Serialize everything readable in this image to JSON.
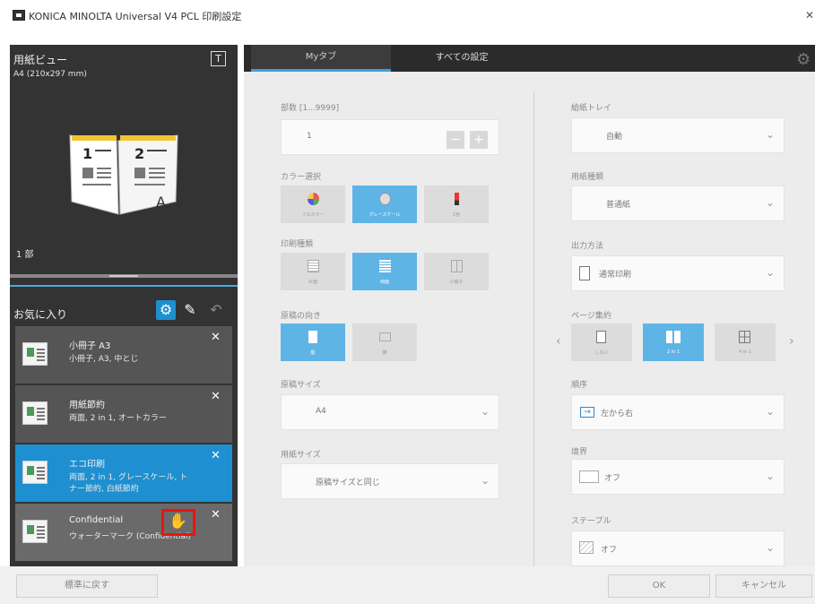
{
  "window": {
    "title": "KONICA MINOLTA Universal V4 PCL 印刷設定"
  },
  "preview": {
    "title": "用紙ビュー",
    "paper_size": "A4 (210x297 mm)",
    "copies_indicator": "1 部",
    "t_icon": "T"
  },
  "favorites": {
    "title": "お気に入り",
    "items": [
      {
        "name": "小冊子 A3",
        "desc": "小冊子, A3, 中とじ"
      },
      {
        "name": "用紙節約",
        "desc": "両面, 2 in 1, オートカラー"
      },
      {
        "name": "エコ印刷",
        "desc": "両面, 2 in 1, グレースケール, ト\nナー節約, 白紙節約"
      },
      {
        "name": "Confidential",
        "desc": "ウォーターマーク (Confidential)"
      }
    ]
  },
  "tabs": {
    "my": "Myタブ",
    "all": "すべての設定"
  },
  "left_col": {
    "copies": {
      "label": "部数 [1...9999]",
      "value": "1"
    },
    "color": {
      "label": "カラー選択",
      "options": [
        "フルカラー",
        "グレースケール",
        "2色"
      ]
    },
    "print_type": {
      "label": "印刷種類",
      "options": [
        "片面",
        "両面",
        "小冊子"
      ]
    },
    "orientation": {
      "label": "原稿の向き",
      "options": [
        "縦",
        "横"
      ]
    },
    "original_size": {
      "label": "原稿サイズ",
      "value": "A4"
    },
    "paper_size": {
      "label": "用紙サイズ",
      "value": "原稿サイズと同じ"
    }
  },
  "right_col": {
    "tray": {
      "label": "給紙トレイ",
      "value": "自動"
    },
    "paper_type": {
      "label": "用紙種類",
      "value": "普通紙"
    },
    "output_method": {
      "label": "出力方法",
      "value": "通常印刷"
    },
    "combine": {
      "label": "ページ集約",
      "options": [
        "しない",
        "2 in 1",
        "4 in 1"
      ]
    },
    "order": {
      "label": "順序",
      "value": "左から右"
    },
    "border": {
      "label": "境界",
      "value": "オフ"
    },
    "staple": {
      "label": "ステープル",
      "value": "オフ"
    }
  },
  "footer": {
    "reset": "標準に戻す",
    "ok": "OK",
    "cancel": "キャンセル"
  }
}
